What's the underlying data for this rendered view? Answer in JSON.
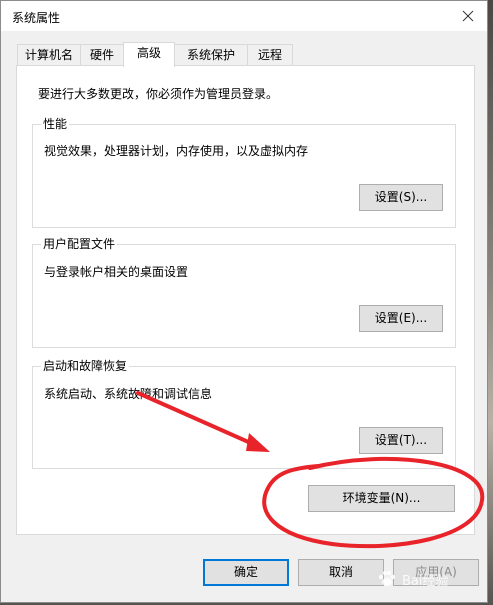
{
  "window": {
    "title": "系统属性"
  },
  "tabs": [
    {
      "label": "计算机名"
    },
    {
      "label": "硬件"
    },
    {
      "label": "高级"
    },
    {
      "label": "系统保护"
    },
    {
      "label": "远程"
    }
  ],
  "active_tab": "高级",
  "panel": {
    "notice": "要进行大多数更改，你必须作为管理员登录。",
    "groups": [
      {
        "title": "性能",
        "description": "视觉效果，处理器计划，内存使用，以及虚拟内存",
        "button": "设置(S)..."
      },
      {
        "title": "用户配置文件",
        "description": "与登录帐户相关的桌面设置",
        "button": "设置(E)..."
      },
      {
        "title": "启动和故障恢复",
        "description": "系统启动、系统故障和调试信息",
        "button": "设置(T)..."
      }
    ],
    "env_button": "环境变量(N)..."
  },
  "footer": {
    "ok": "确定",
    "cancel": "取消",
    "apply": "应用(A)"
  },
  "watermark": {
    "text": "Bai经验"
  },
  "colors": {
    "annotation": "#e8232a",
    "focus_border": "#0078d7",
    "button_face": "#e1e1e1",
    "panel_bg": "#ffffff",
    "dialog_bg": "#f0f0f0"
  },
  "icons": {
    "close": "close-icon",
    "watermark_logo": "paw-icon"
  }
}
